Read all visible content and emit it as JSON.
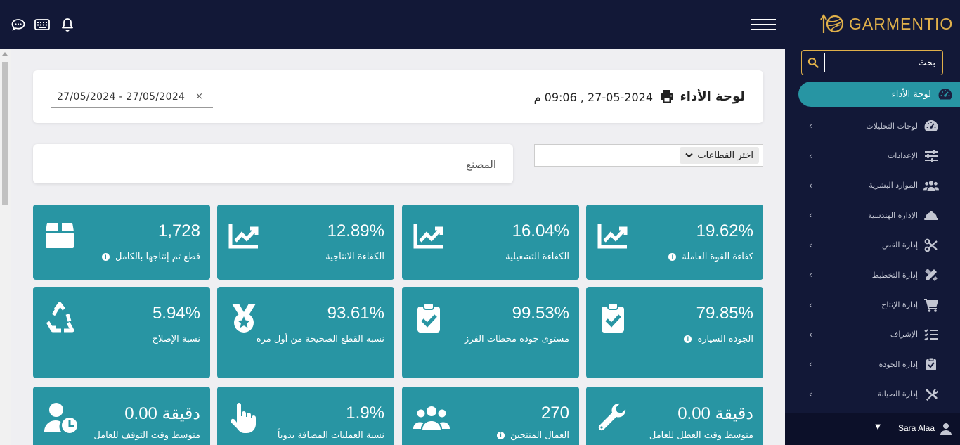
{
  "app": {
    "logo_text": "GARMENTIO"
  },
  "icons": {
    "chat": "chat-icon",
    "keyboard": "keyboard-icon",
    "bell": "bell-icon",
    "menu": "hamburger-icon",
    "search": "search-icon",
    "print": "print-icon"
  },
  "colors": {
    "navy": "#121837",
    "teal": "#2895a3",
    "gold": "#e0b04a"
  },
  "sidebar": {
    "search_placeholder": "بحث",
    "items": [
      {
        "label": "لوحة الأداء",
        "icon": "dashboard-icon",
        "active": true
      },
      {
        "label": "لوحات التحليلات",
        "icon": "gauge-icon"
      },
      {
        "label": "الإعدادات",
        "icon": "sliders-icon"
      },
      {
        "label": "الموارد البشرية",
        "icon": "users-icon"
      },
      {
        "label": "الإدارة الهندسية",
        "icon": "hardhat-icon"
      },
      {
        "label": "إدارة القص",
        "icon": "scissors-icon"
      },
      {
        "label": "إدارة التخطيط",
        "icon": "ruler-pencil-icon"
      },
      {
        "label": "إدارة الإنتاج",
        "icon": "cart-icon"
      },
      {
        "label": "الإشراف",
        "icon": "tasks-icon"
      },
      {
        "label": "إدارة الجودة",
        "icon": "clipboard-check-icon"
      },
      {
        "label": "إدارة الصيانة",
        "icon": "tools-icon"
      }
    ],
    "user": {
      "name": "Sara Alaa"
    }
  },
  "header": {
    "title": "لوحة الأداء",
    "datetime": "27-05-2024 , 09:06 م",
    "date_range": "27/05/2024  -  27/05/2024",
    "clear": "×"
  },
  "filters": {
    "factory": "المصنع",
    "sector_select": "اختر القطاعات"
  },
  "kpis": [
    {
      "value": "19.62%",
      "label": "كفاءة القوة العاملة",
      "info": true,
      "icon": "chart-line-icon"
    },
    {
      "value": "16.04%",
      "label": "الكفاءة التشغيلية",
      "info": false,
      "icon": "chart-line-icon"
    },
    {
      "value": "12.89%",
      "label": "الكفاءة الانتاجية",
      "info": false,
      "icon": "chart-line-icon"
    },
    {
      "value": "1,728",
      "label": "قطع تم إنتاجها بالكامل",
      "info": true,
      "icon": "box-icon"
    },
    {
      "value": "79.85%",
      "label": "الجودة السيارة",
      "info": true,
      "icon": "clipboard-check-icon"
    },
    {
      "value": "99.53%",
      "label": "مستوى جودة محطات الفرز",
      "info": false,
      "icon": "clipboard-check-icon"
    },
    {
      "value": "93.61%",
      "label": "نسبه القطع الصحيحة من أول مره",
      "info": false,
      "icon": "medal-icon"
    },
    {
      "value": "5.94%",
      "label": "نسبة الإصلاح",
      "info": false,
      "icon": "recycle-icon"
    },
    {
      "value": "0.00 دقيقة",
      "label": "متوسط وقت العطل للعامل",
      "info": false,
      "icon": "wrench-icon"
    },
    {
      "value": "270",
      "label": "العمال المنتجين",
      "info": true,
      "icon": "users-icon"
    },
    {
      "value": "1.9%",
      "label": "نسبة العمليات المضافة يدوياً",
      "info": false,
      "icon": "hand-pointer-icon"
    },
    {
      "value": "0.00 دقيقة",
      "label": "متوسط وقت التوقف للعامل",
      "info": false,
      "icon": "user-clock-icon"
    }
  ]
}
